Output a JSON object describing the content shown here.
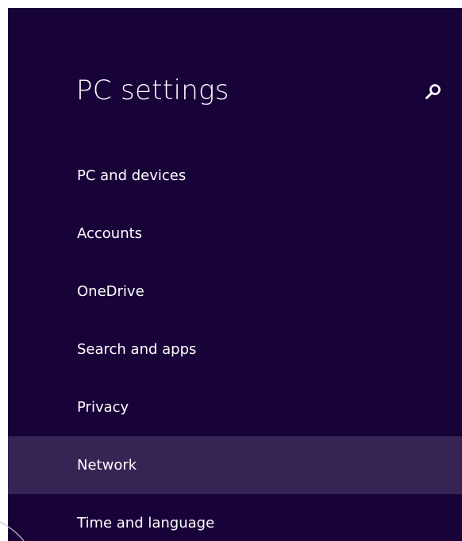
{
  "page": {
    "title": "PC settings"
  },
  "search": {
    "icon": "search-icon"
  },
  "nav": {
    "items": [
      {
        "label": "PC and devices"
      },
      {
        "label": "Accounts"
      },
      {
        "label": "OneDrive"
      },
      {
        "label": "Search and apps"
      },
      {
        "label": "Privacy"
      },
      {
        "label": "Network",
        "selected": true
      },
      {
        "label": "Time and language"
      }
    ]
  },
  "colors": {
    "background": "#180339",
    "selected_item": "#362454",
    "text": "#ffffff"
  }
}
